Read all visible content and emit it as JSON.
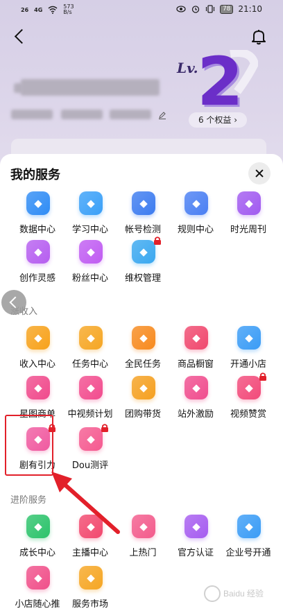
{
  "status_bar": {
    "signal1": "26",
    "signal2": "4G",
    "net_speed": "573\nB/s",
    "battery": "78",
    "time": "21:10"
  },
  "level": {
    "prefix": "Lv.",
    "number": "2"
  },
  "rights_button": "6 个权益 ›",
  "sheet": {
    "title": "我的服务",
    "sections": [
      {
        "name": "",
        "items": [
          {
            "label": "数据中心",
            "icon": "data-center-icon",
            "color": "#2f8cf5"
          },
          {
            "label": "学习中心",
            "icon": "learning-center-icon",
            "color": "#3aa0f8"
          },
          {
            "label": "帐号检测",
            "icon": "account-check-icon",
            "color": "#3d7cf0"
          },
          {
            "label": "规则中心",
            "icon": "rules-center-icon",
            "color": "#4a7ff3"
          },
          {
            "label": "时光周刊",
            "icon": "time-weekly-icon",
            "color": "#a15af0"
          },
          {
            "label": "创作灵感",
            "icon": "inspiration-icon",
            "color": "#b65ef0"
          },
          {
            "label": "粉丝中心",
            "icon": "fans-center-icon",
            "color": "#c05cf2"
          },
          {
            "label": "维权管理",
            "icon": "rights-protection-icon",
            "color": "#3aa8f0"
          }
        ]
      },
      {
        "name": "涨收入",
        "items": [
          {
            "label": "收入中心",
            "icon": "income-center-icon",
            "color": "#f7a21b"
          },
          {
            "label": "任务中心",
            "icon": "task-center-icon",
            "color": "#f6a623"
          },
          {
            "label": "全民任务",
            "icon": "public-task-icon",
            "color": "#f78a1e"
          },
          {
            "label": "商品橱窗",
            "icon": "product-window-icon",
            "color": "#f0486e"
          },
          {
            "label": "开通小店",
            "icon": "open-shop-icon",
            "color": "#3a9cf6"
          },
          {
            "label": "星图商单",
            "icon": "star-map-icon",
            "color": "#f04a8c"
          },
          {
            "label": "中视频计划",
            "icon": "mid-video-icon",
            "color": "#f24c8e"
          },
          {
            "label": "团购带货",
            "icon": "group-buy-icon",
            "color": "#f5a020"
          },
          {
            "label": "站外激励",
            "icon": "offsite-reward-icon",
            "color": "#f04d8e"
          },
          {
            "label": "视频赞赏",
            "icon": "video-tip-icon",
            "color": "#f24a7a"
          },
          {
            "label": "剧有引力",
            "icon": "drama-gravity-icon",
            "color": "#f05aa0"
          },
          {
            "label": "Dou测评",
            "icon": "dou-review-icon",
            "color": "#f55a90"
          }
        ]
      },
      {
        "name": "进阶服务",
        "items": [
          {
            "label": "成长中心",
            "icon": "growth-center-icon",
            "color": "#2cc36b"
          },
          {
            "label": "主播中心",
            "icon": "anchor-center-icon",
            "color": "#f2486e"
          },
          {
            "label": "上热门",
            "icon": "go-trending-icon",
            "color": "#f35b8c"
          },
          {
            "label": "官方认证",
            "icon": "official-verify-icon",
            "color": "#a65cf0"
          },
          {
            "label": "企业号开通",
            "icon": "enterprise-account-icon",
            "color": "#3a9cf6"
          },
          {
            "label": "小店随心推",
            "icon": "shop-promote-icon",
            "color": "#f0508a"
          },
          {
            "label": "服务市场",
            "icon": "service-market-icon",
            "color": "#f6a623"
          }
        ]
      }
    ]
  },
  "watermark": "Baidu 经验"
}
